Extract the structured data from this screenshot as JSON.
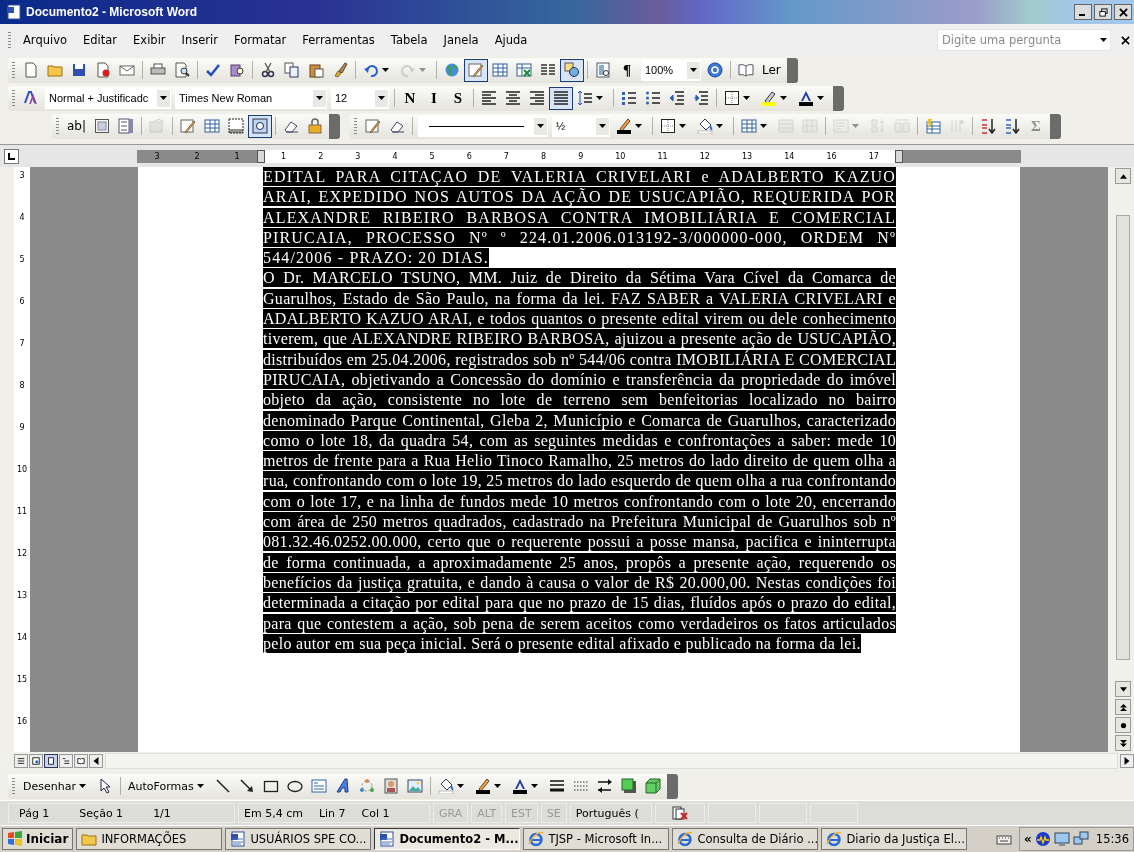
{
  "window": {
    "title": "Documento2 - Microsoft Word"
  },
  "menu": [
    {
      "label": "Arquivo"
    },
    {
      "label": "Editar"
    },
    {
      "label": "Exibir"
    },
    {
      "label": "Inserir"
    },
    {
      "label": "Formatar"
    },
    {
      "label": "Ferramentas"
    },
    {
      "label": "Tabela"
    },
    {
      "label": "Janela"
    },
    {
      "label": "Ajuda"
    }
  ],
  "help_box": {
    "placeholder": "Digite uma pergunta"
  },
  "standard_toolbar": [
    {
      "kind": "icon",
      "pressed": false,
      "disabled": false,
      "dropdown": false
    },
    {
      "kind": "icon",
      "pressed": false,
      "disabled": false,
      "dropdown": false
    },
    {
      "kind": "icon",
      "pressed": false,
      "disabled": false,
      "dropdown": false
    },
    {
      "kind": "icon",
      "pressed": false,
      "disabled": false,
      "dropdown": false
    },
    {
      "kind": "icon",
      "pressed": false,
      "disabled": false,
      "dropdown": false
    },
    {
      "kind": "sep"
    },
    {
      "kind": "icon",
      "pressed": false,
      "disabled": false,
      "dropdown": false
    },
    {
      "kind": "icon",
      "pressed": false,
      "disabled": false,
      "dropdown": false
    },
    {
      "kind": "sep"
    },
    {
      "kind": "icon",
      "pressed": false,
      "disabled": false,
      "dropdown": false
    },
    {
      "kind": "icon",
      "pressed": false,
      "disabled": false,
      "dropdown": false
    },
    {
      "kind": "sep"
    },
    {
      "kind": "icon",
      "pressed": false,
      "disabled": false,
      "dropdown": false
    },
    {
      "kind": "icon",
      "pressed": false,
      "disabled": false,
      "dropdown": false
    },
    {
      "kind": "icon",
      "pressed": false,
      "disabled": false,
      "dropdown": false
    },
    {
      "kind": "icon",
      "pressed": false,
      "disabled": false,
      "dropdown": false
    },
    {
      "kind": "sep"
    },
    {
      "kind": "icon",
      "pressed": false,
      "disabled": false,
      "dropdown": true
    },
    {
      "kind": "icon",
      "pressed": false,
      "disabled": true,
      "dropdown": true
    },
    {
      "kind": "sep"
    },
    {
      "kind": "icon",
      "pressed": false,
      "disabled": false,
      "dropdown": false
    },
    {
      "kind": "icon",
      "pressed": true,
      "disabled": false,
      "dropdown": false
    },
    {
      "kind": "icon",
      "pressed": false,
      "disabled": false,
      "dropdown": false
    },
    {
      "kind": "icon",
      "pressed": false,
      "disabled": false,
      "dropdown": false
    },
    {
      "kind": "icon",
      "pressed": false,
      "disabled": false,
      "dropdown": false
    },
    {
      "kind": "icon",
      "pressed": true,
      "disabled": false,
      "dropdown": false
    },
    {
      "kind": "sep"
    },
    {
      "kind": "icon",
      "pressed": false,
      "disabled": false,
      "dropdown": false
    },
    {
      "kind": "label",
      "label": "¶",
      "pressed": false,
      "disabled": false,
      "dropdown": false
    },
    {
      "kind": "combo",
      "value": "100%"
    },
    {
      "kind": "icon",
      "pressed": false,
      "disabled": false,
      "dropdown": false
    },
    {
      "kind": "sep"
    },
    {
      "kind": "icon",
      "pressed": false,
      "disabled": false,
      "dropdown": false
    },
    {
      "kind": "label",
      "label": "Ler",
      "pressed": false,
      "disabled": false,
      "dropdown": false
    }
  ],
  "formatting_toolbar": [
    {
      "kind": "icon",
      "pressed": false,
      "disabled": false,
      "dropdown": false
    },
    {
      "kind": "combo",
      "value": "Normal + Justificadc"
    },
    {
      "kind": "combo",
      "value": "Times New Roman"
    },
    {
      "kind": "combo",
      "value": "12"
    },
    {
      "kind": "sep"
    },
    {
      "kind": "label",
      "label": "N",
      "pressed": false,
      "disabled": false,
      "dropdown": false
    },
    {
      "kind": "label",
      "label": "I",
      "pressed": false,
      "disabled": false,
      "dropdown": false
    },
    {
      "kind": "label",
      "label": "S",
      "pressed": false,
      "disabled": false,
      "dropdown": false
    },
    {
      "kind": "sep"
    },
    {
      "kind": "icon",
      "pressed": false,
      "disabled": false,
      "dropdown": false
    },
    {
      "kind": "icon",
      "pressed": false,
      "disabled": false,
      "dropdown": false
    },
    {
      "kind": "icon",
      "pressed": false,
      "disabled": false,
      "dropdown": false
    },
    {
      "kind": "icon",
      "pressed": true,
      "disabled": false,
      "dropdown": false
    },
    {
      "kind": "icon",
      "pressed": false,
      "disabled": false,
      "dropdown": true
    },
    {
      "kind": "sep"
    },
    {
      "kind": "icon",
      "pressed": false,
      "disabled": false,
      "dropdown": false
    },
    {
      "kind": "icon",
      "pressed": false,
      "disabled": false,
      "dropdown": false
    },
    {
      "kind": "icon",
      "pressed": false,
      "disabled": false,
      "dropdown": false
    },
    {
      "kind": "icon",
      "pressed": false,
      "disabled": false,
      "dropdown": false
    },
    {
      "kind": "sep"
    },
    {
      "kind": "icon",
      "pressed": false,
      "disabled": false,
      "dropdown": true
    },
    {
      "kind": "icon",
      "pressed": false,
      "disabled": false,
      "dropdown": true
    },
    {
      "kind": "icon",
      "pressed": false,
      "disabled": false,
      "dropdown": true
    }
  ],
  "forms_toolbar": [
    {
      "kind": "label",
      "label": "ab|",
      "pressed": false,
      "disabled": false,
      "dropdown": false
    },
    {
      "kind": "icon",
      "pressed": false,
      "disabled": false,
      "dropdown": false
    },
    {
      "kind": "icon",
      "pressed": false,
      "disabled": false,
      "dropdown": false
    },
    {
      "kind": "sep"
    },
    {
      "kind": "icon",
      "pressed": false,
      "disabled": true,
      "dropdown": false
    },
    {
      "kind": "sep"
    },
    {
      "kind": "icon",
      "pressed": false,
      "disabled": false,
      "dropdown": false
    },
    {
      "kind": "icon",
      "pressed": false,
      "disabled": false,
      "dropdown": false
    },
    {
      "kind": "icon",
      "pressed": false,
      "disabled": false,
      "dropdown": false
    },
    {
      "kind": "icon",
      "pressed": true,
      "disabled": false,
      "dropdown": false
    },
    {
      "kind": "sep"
    },
    {
      "kind": "icon",
      "pressed": false,
      "disabled": false,
      "dropdown": false
    },
    {
      "kind": "icon",
      "pressed": false,
      "disabled": false,
      "dropdown": false
    }
  ],
  "tables_toolbar": [
    {
      "kind": "icon",
      "pressed": false,
      "disabled": false,
      "dropdown": false
    },
    {
      "kind": "icon",
      "pressed": false,
      "disabled": false,
      "dropdown": false
    },
    {
      "kind": "sep"
    },
    {
      "kind": "linecombo"
    },
    {
      "kind": "combo",
      "value": "½"
    },
    {
      "kind": "icon",
      "pressed": false,
      "disabled": false,
      "dropdown": true
    },
    {
      "kind": "sep"
    },
    {
      "kind": "icon",
      "pressed": false,
      "disabled": false,
      "dropdown": true
    },
    {
      "kind": "icon",
      "pressed": false,
      "disabled": false,
      "dropdown": true
    },
    {
      "kind": "sep"
    },
    {
      "kind": "icon",
      "pressed": false,
      "disabled": false,
      "dropdown": true
    },
    {
      "kind": "icon",
      "pressed": false,
      "disabled": true,
      "dropdown": false
    },
    {
      "kind": "icon",
      "pressed": false,
      "disabled": true,
      "dropdown": false
    },
    {
      "kind": "sep"
    },
    {
      "kind": "icon",
      "pressed": false,
      "disabled": true,
      "dropdown": true
    },
    {
      "kind": "icon",
      "pressed": false,
      "disabled": true,
      "dropdown": false
    },
    {
      "kind": "icon",
      "pressed": false,
      "disabled": true,
      "dropdown": false
    },
    {
      "kind": "sep"
    },
    {
      "kind": "icon",
      "pressed": false,
      "disabled": false,
      "dropdown": false
    },
    {
      "kind": "icon",
      "pressed": false,
      "disabled": true,
      "dropdown": false
    },
    {
      "kind": "sep"
    },
    {
      "kind": "icon",
      "pressed": false,
      "disabled": false,
      "dropdown": false
    },
    {
      "kind": "icon",
      "pressed": false,
      "disabled": false,
      "dropdown": false
    },
    {
      "kind": "label",
      "label": "Σ",
      "pressed": false,
      "disabled": true,
      "dropdown": false
    }
  ],
  "ruler": {
    "left_numbers": [
      "3",
      "2",
      "1"
    ],
    "right_numbers": [
      "1",
      "2",
      "3",
      "4",
      "5",
      "6",
      "7",
      "8",
      "9",
      "10",
      "11",
      "12",
      "13",
      "14",
      "16",
      "17"
    ]
  },
  "vertical_ruler": {
    "numbers": [
      "3",
      "4",
      "5",
      "6",
      "7",
      "8",
      "9",
      "10",
      "11",
      "12",
      "13",
      "14",
      "15",
      "16"
    ]
  },
  "document": {
    "paragraphs": [
      {
        "text": "EDITAL PARA CITAÇAO DE VALERIA CRIVELARI e ADALBERTO KAZUO ARAI, EXPEDIDO NOS AUTOS DA AÇÃO DE USUCAPIÃO, REQUERIDA POR ALEXANDRE RIBEIRO BARBOSA CONTRA IMOBILIÁRIA E COMERCIAL PIRUCAIA, PROCESSO Nº º 224.01.2006.013192-3/000000-000, ORDEM Nº 544/2006 - PRAZO: 20 DIAS.",
        "selected": true
      },
      {
        "text": "O Dr. MARCELO TSUNO, MM. Juiz de Direito da Sétima Vara Cível da Comarca de Guarulhos, Estado de São Paulo, na forma da lei. FAZ SABER a VALERIA CRIVELARI e ADALBERTO KAZUO ARAI, e todos quantos o presente edital virem ou dele conhecimento tiverem, que ALEXANDRE RIBEIRO BARBOSA, ajuizou a presente ação de USUCAPIÃO, distribuídos em 25.04.2006, registrados sob nº 544/06 contra IMOBILIÁRIA E COMERCIAL PIRUCAIA, objetivando a Concessão do domínio e transferência da propriedade do imóvel objeto da ação, consistente no lote de terreno sem benfeitorias localizado no bairro denominado Parque Continental, Gleba 2, Município e Comarca de Guarulhos, caracterizado como o lote 18, da quadra 54, com as seguintes medidas e confrontações a saber: mede 10 metros de frente para a Rua Helio Tinoco Ramalho, 25 metros do lado direito de quem olha a rua, confrontando com o lote 19, 25 metros do lado esquerdo de quem olha a rua confrontando com o lote 17, e na linha de fundos mede 10 metros confrontando com o lote 20, encerrando com área de 250 metros quadrados, cadastrado na Prefeitura Municipal de Guarulhos sob nº 081.32.46.0252.00.000, certo que o requerente possui a posse mansa, pacifica e ininterrupta de forma continuada, a aproximadamente 25 anos, propôs a presente ação, requerendo os benefícios da justiça gratuita, e dando à causa o valor de R$ 20.000,00. Nestas condições foi determinada a citação por edital para que no prazo de 15 dias, fluídos após o prazo do edital, para que contestem a ação, sob pena de serem aceitos como verdadeiros os fatos articulados pelo autor em sua peça inicial. Será o presente edital afixado e publicado na forma da lei.",
        "selected": true
      }
    ]
  },
  "drawing_toolbar": [
    {
      "kind": "label",
      "label": "Desenhar",
      "pressed": false,
      "disabled": false,
      "dropdown": true
    },
    {
      "kind": "icon",
      "pressed": false,
      "disabled": false,
      "dropdown": false
    },
    {
      "kind": "sep"
    },
    {
      "kind": "label",
      "label": "AutoFormas",
      "pressed": false,
      "disabled": false,
      "dropdown": true
    },
    {
      "kind": "icon",
      "pressed": false,
      "disabled": false,
      "dropdown": false
    },
    {
      "kind": "icon",
      "pressed": false,
      "disabled": false,
      "dropdown": false
    },
    {
      "kind": "icon",
      "pressed": false,
      "disabled": false,
      "dropdown": false
    },
    {
      "kind": "icon",
      "pressed": false,
      "disabled": false,
      "dropdown": false
    },
    {
      "kind": "icon",
      "pressed": false,
      "disabled": false,
      "dropdown": false
    },
    {
      "kind": "icon",
      "pressed": false,
      "disabled": false,
      "dropdown": false
    },
    {
      "kind": "icon",
      "pressed": false,
      "disabled": false,
      "dropdown": false
    },
    {
      "kind": "icon",
      "pressed": false,
      "disabled": false,
      "dropdown": false
    },
    {
      "kind": "icon",
      "pressed": false,
      "disabled": false,
      "dropdown": false
    },
    {
      "kind": "sep"
    },
    {
      "kind": "icon",
      "pressed": false,
      "disabled": false,
      "dropdown": true
    },
    {
      "kind": "icon",
      "pressed": false,
      "disabled": false,
      "dropdown": true
    },
    {
      "kind": "icon",
      "pressed": false,
      "disabled": false,
      "dropdown": true
    },
    {
      "kind": "icon",
      "pressed": false,
      "disabled": false,
      "dropdown": false
    },
    {
      "kind": "icon",
      "pressed": false,
      "disabled": false,
      "dropdown": false
    },
    {
      "kind": "icon",
      "pressed": false,
      "disabled": false,
      "dropdown": false
    },
    {
      "kind": "icon",
      "pressed": false,
      "disabled": false,
      "dropdown": false
    },
    {
      "kind": "icon",
      "pressed": false,
      "disabled": false,
      "dropdown": false
    }
  ],
  "status_bar": {
    "page": "Pág 1",
    "section": "Seção 1",
    "pages": "1/1",
    "position": "Em 5,4 cm",
    "line": "Lin 7",
    "column": "Col 1",
    "modes": [
      {
        "label": "GRA",
        "disabled": true
      },
      {
        "label": "ALT",
        "disabled": true
      },
      {
        "label": "EST",
        "disabled": true
      },
      {
        "label": "SE",
        "disabled": true
      }
    ],
    "language": "Português ("
  },
  "taskbar": {
    "start": "Iniciar",
    "tasks": [
      {
        "kind": "folder",
        "label": "INFORMAÇÕES",
        "selected": false
      },
      {
        "kind": "word",
        "label": "USUÁRIOS SPE CO...",
        "selected": false
      },
      {
        "kind": "word",
        "label": "Documento2 - M...",
        "selected": true
      },
      {
        "kind": "browser",
        "label": "TJSP - Microsoft In...",
        "selected": false
      },
      {
        "kind": "browser",
        "label": "Consulta de Diário ...",
        "selected": false
      },
      {
        "kind": "browser",
        "label": "Diario da Justiça El...",
        "selected": false
      }
    ],
    "tray_expand": "«",
    "clock": "15:36"
  }
}
